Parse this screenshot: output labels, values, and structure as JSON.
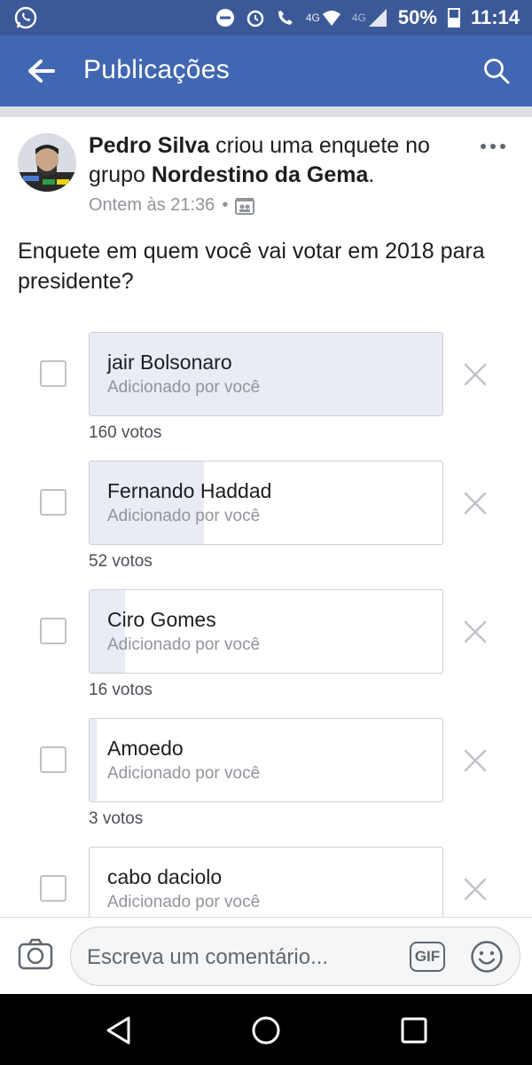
{
  "status_bar": {
    "network_label": "4G",
    "network_label_2": "4G",
    "battery": "50%",
    "time": "11:14"
  },
  "header": {
    "title": "Publicações"
  },
  "post": {
    "author": "Pedro Silva",
    "action_text": " criou uma enquete no grupo ",
    "group": "Nordestino da Gema",
    "punct": ".",
    "time": "Ontem às 21:36",
    "separator": "•",
    "question": "Enquete em quem você vai votar em 2018 para presidente?"
  },
  "poll": {
    "options": [
      {
        "name": "jair Bolsonaro",
        "added_by": "Adicionado por você",
        "votes_label": "160 votos",
        "votes": 160,
        "fill_fraction": 1.0
      },
      {
        "name": "Fernando Haddad",
        "added_by": "Adicionado por você",
        "votes_label": "52 votos",
        "votes": 52,
        "fill_fraction": 0.325
      },
      {
        "name": "Ciro Gomes",
        "added_by": "Adicionado por você",
        "votes_label": "16 votos",
        "votes": 16,
        "fill_fraction": 0.1
      },
      {
        "name": "Amoedo",
        "added_by": "Adicionado por você",
        "votes_label": "3 votos",
        "votes": 3,
        "fill_fraction": 0.019
      },
      {
        "name": "cabo daciolo",
        "added_by": "Adicionado por você",
        "votes_label": "",
        "votes": null,
        "fill_fraction": 0.0
      }
    ]
  },
  "comment_bar": {
    "placeholder": "Escreva um comentário...",
    "gif_label": "GIF"
  },
  "colors": {
    "brand": "#4267b2",
    "status_bar": "#3b5998",
    "poll_fill": "#e9ebf5"
  }
}
